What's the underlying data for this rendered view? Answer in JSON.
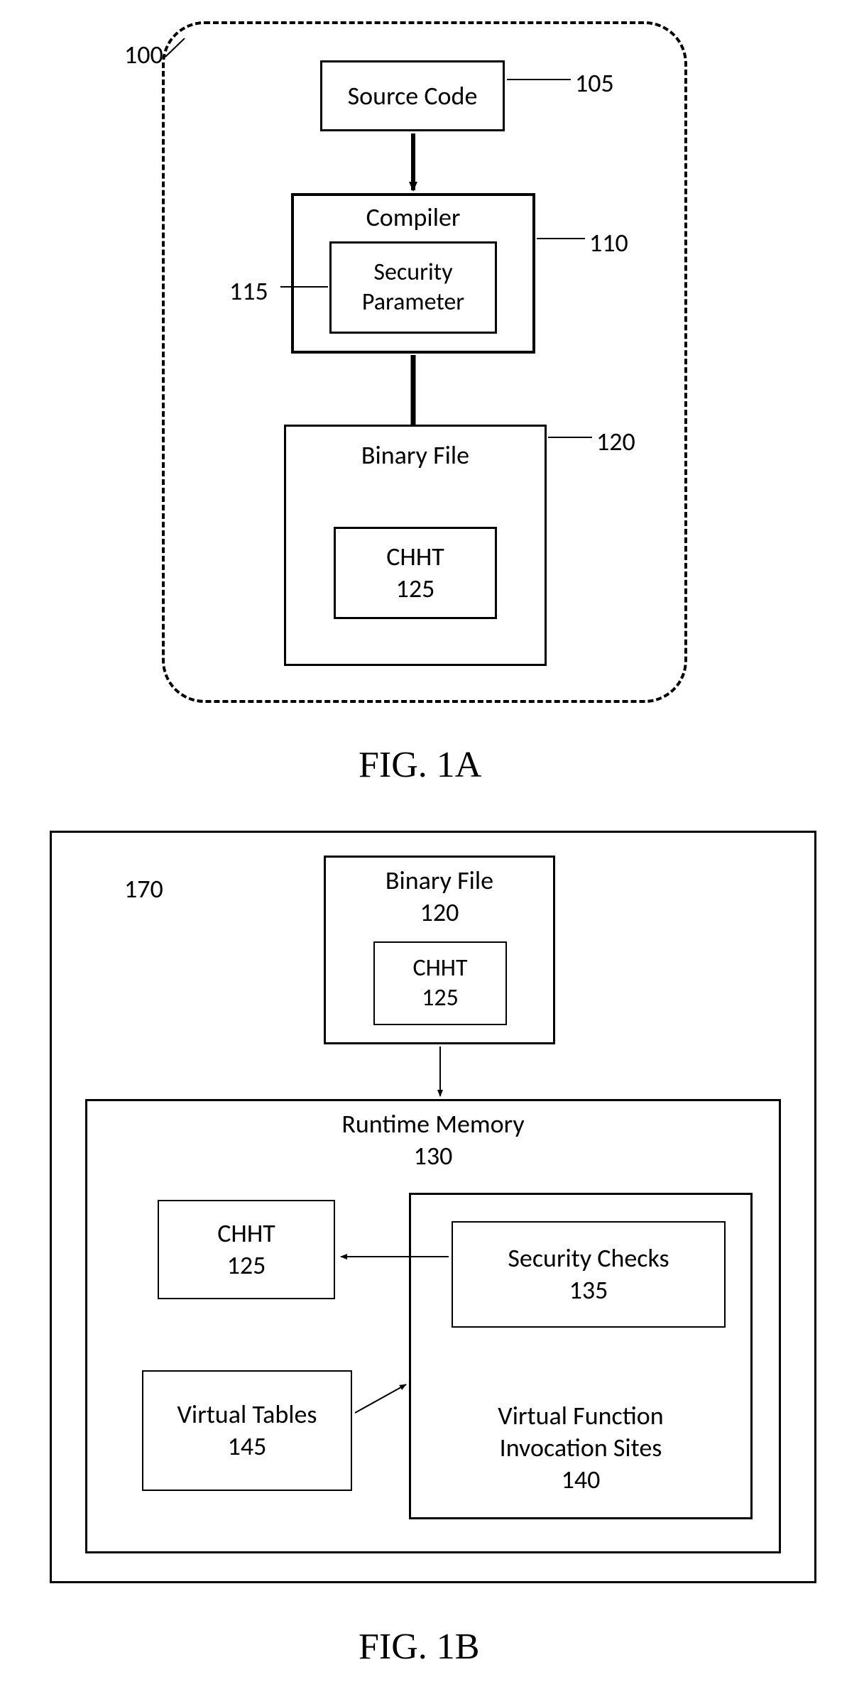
{
  "fig1a": {
    "container_ref": "100",
    "source_code": {
      "label": "Source Code",
      "ref": "105"
    },
    "compiler": {
      "label": "Compiler",
      "ref": "110"
    },
    "security_param": {
      "label": "Security\nParameter",
      "ref": "115"
    },
    "binary_file": {
      "label": "Binary File",
      "ref": "120"
    },
    "chht": {
      "label": "CHHT",
      "ref": "125"
    },
    "caption": "FIG. 1A"
  },
  "fig1b": {
    "container_ref": "170",
    "binary_file": {
      "label": "Binary File",
      "ref": "120"
    },
    "chht_top": {
      "label": "CHHT",
      "ref": "125"
    },
    "runtime_memory": {
      "label": "Runtime Memory",
      "ref": "130"
    },
    "chht_left": {
      "label": "CHHT",
      "ref": "125"
    },
    "virtual_tables": {
      "label": "Virtual Tables",
      "ref": "145"
    },
    "security_checks": {
      "label": "Security Checks",
      "ref": "135"
    },
    "vf_invocation": {
      "label": "Virtual Function\nInvocation Sites",
      "ref": "140"
    },
    "caption": "FIG. 1B"
  }
}
